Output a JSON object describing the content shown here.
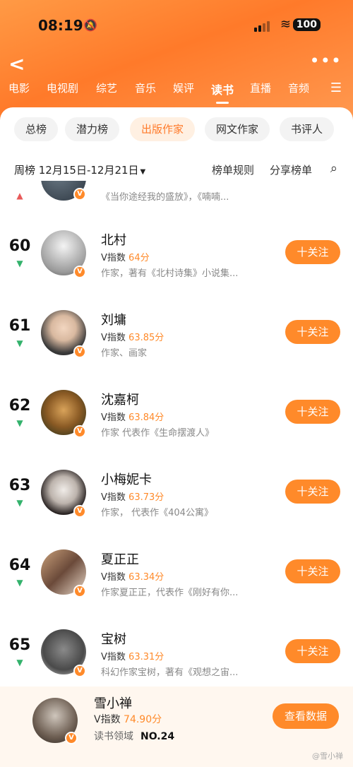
{
  "status": {
    "time": "08:19",
    "battery": "100"
  },
  "categories": [
    {
      "label": "电影",
      "active": false
    },
    {
      "label": "电视剧",
      "active": false
    },
    {
      "label": "综艺",
      "active": false
    },
    {
      "label": "音乐",
      "active": false
    },
    {
      "label": "娱评",
      "active": false
    },
    {
      "label": "读书",
      "active": true
    },
    {
      "label": "直播",
      "active": false
    },
    {
      "label": "音频",
      "active": false
    }
  ],
  "subtabs": [
    {
      "label": "总榜",
      "active": false
    },
    {
      "label": "潜力榜",
      "active": false
    },
    {
      "label": "出版作家",
      "active": true
    },
    {
      "label": "网文作家",
      "active": false
    },
    {
      "label": "书评人",
      "active": false
    }
  ],
  "weekbar": {
    "week": "周榜 12月15日-12月21日",
    "rules": "榜单规则",
    "share": "分享榜单"
  },
  "partial_row": {
    "desc": "《当你途经我的盛放》，《喃喃..."
  },
  "list": [
    {
      "rank": "60",
      "name": "北村",
      "vlabel": "V指数",
      "score": "64分",
      "desc": "作家，著有《北村诗集》小说集...",
      "follow": "十关注"
    },
    {
      "rank": "61",
      "name": "刘墉",
      "vlabel": "V指数",
      "score": "63.85分",
      "desc": "作家、画家",
      "follow": "十关注"
    },
    {
      "rank": "62",
      "name": "沈嘉柯",
      "vlabel": "V指数",
      "score": "63.84分",
      "desc": "作家 代表作《生命摆渡人》",
      "follow": "十关注"
    },
    {
      "rank": "63",
      "name": "小梅妮卡",
      "vlabel": "V指数",
      "score": "63.73分",
      "desc": "作家， 代表作《404公寓》",
      "follow": "十关注"
    },
    {
      "rank": "64",
      "name": "夏正正",
      "vlabel": "V指数",
      "score": "63.34分",
      "desc": "作家夏正正，代表作《刚好有你...",
      "follow": "十关注"
    },
    {
      "rank": "65",
      "name": "宝树",
      "vlabel": "V指数",
      "score": "63.31分",
      "desc": "科幻作家宝树，著有《观想之宙...",
      "follow": "十关注"
    }
  ],
  "bottom": {
    "name": "雪小禅",
    "vlabel": "V指数",
    "score": "74.90分",
    "field": "读书领域",
    "rank": "NO.24",
    "button": "查看数据"
  },
  "watermark": "@雪小禅"
}
